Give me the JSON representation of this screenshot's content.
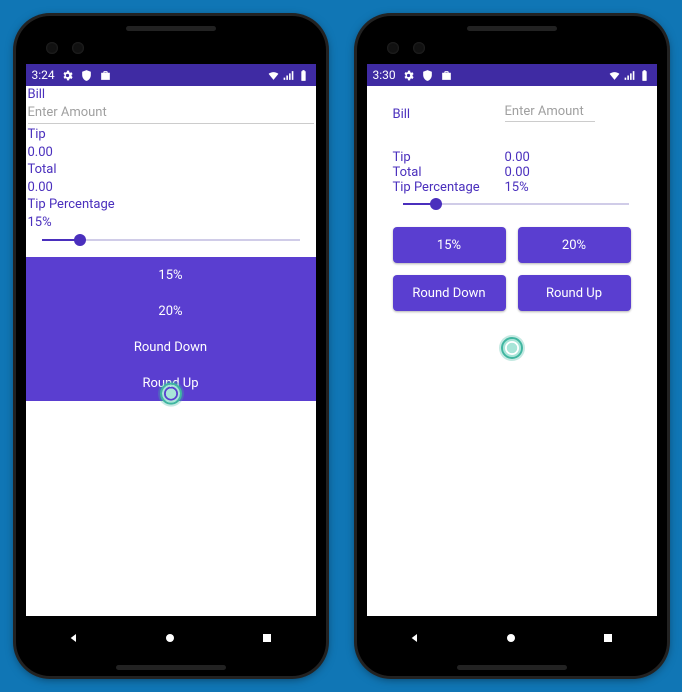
{
  "phoneA": {
    "time": "3:24",
    "bill_label": "Bill",
    "bill_placeholder": "Enter Amount",
    "tip_label": "Tip",
    "tip_value": "0.00",
    "total_label": "Total",
    "total_value": "0.00",
    "tip_pct_label": "Tip Percentage",
    "tip_pct_value": "15%",
    "slider_pct": 15,
    "buttons": {
      "p15": "15%",
      "p20": "20%",
      "rdown": "Round Down",
      "rup": "Round Up"
    }
  },
  "phoneB": {
    "time": "3:30",
    "bill_label": "Bill",
    "bill_placeholder": "Enter Amount",
    "tip_label": "Tip",
    "tip_value": "0.00",
    "total_label": "Total",
    "total_value": "0.00",
    "tip_pct_label": "Tip Percentage",
    "tip_pct_value": "15%",
    "slider_pct": 15,
    "buttons": {
      "p15": "15%",
      "p20": "20%",
      "rdown": "Round Down",
      "rup": "Round Up"
    }
  }
}
